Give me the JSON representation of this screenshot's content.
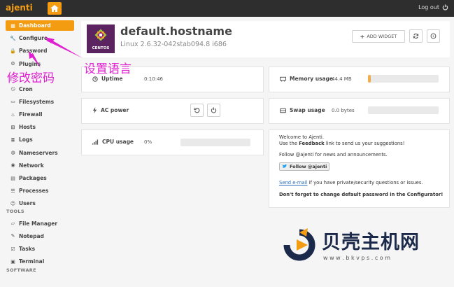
{
  "topbar": {
    "brand": "ajenti",
    "logout": "Log out"
  },
  "sidebar": {
    "items": [
      {
        "label": "Dashboard",
        "icon": "dashboard-icon",
        "active": true
      },
      {
        "label": "Configure",
        "icon": "wrench-icon"
      },
      {
        "label": "Password",
        "icon": "lock-icon"
      },
      {
        "label": "Plugins",
        "icon": "cogs-icon"
      },
      {
        "label": "Cron",
        "icon": "clock-icon"
      },
      {
        "label": "Filesystems",
        "icon": "hdd-icon"
      },
      {
        "label": "Firewall",
        "icon": "fire-icon"
      },
      {
        "label": "Hosts",
        "icon": "sitemap-icon"
      },
      {
        "label": "Logs",
        "icon": "logs-icon"
      },
      {
        "label": "Nameservers",
        "icon": "globe-icon"
      },
      {
        "label": "Network",
        "icon": "network-icon"
      },
      {
        "label": "Packages",
        "icon": "packages-icon"
      },
      {
        "label": "Processes",
        "icon": "list-icon"
      },
      {
        "label": "Users",
        "icon": "users-icon"
      }
    ],
    "tools_heading": "TOOLS",
    "tools": [
      {
        "label": "File Manager",
        "icon": "folder-icon"
      },
      {
        "label": "Notepad",
        "icon": "edit-icon"
      },
      {
        "label": "Tasks",
        "icon": "tasks-icon"
      },
      {
        "label": "Terminal",
        "icon": "terminal-icon"
      }
    ],
    "software_heading": "SOFTWARE"
  },
  "header": {
    "logo_text": "CENTOS",
    "hostname": "default.hostname",
    "kernel": "Linux 2.6.32-042stab094.8 i686",
    "add_widget": "ADD WIDGET"
  },
  "widgets": {
    "uptime": {
      "label": "Uptime",
      "value": "0:10:46"
    },
    "memory": {
      "label": "Memory usage",
      "value": "44.4 MB",
      "fraction": 0.04
    },
    "ac_power": {
      "label": "AC power"
    },
    "swap": {
      "label": "Swap usage",
      "value": "0.0 bytes",
      "fraction": 0
    },
    "cpu": {
      "label": "CPU usage",
      "value": "0%",
      "fraction": 0
    }
  },
  "welcome": {
    "line1": "Welcome to Ajenti.",
    "line2_pre": "Use the ",
    "line2_bold": "Feedback",
    "line2_post": " link to send us your suggestions!",
    "line3": "Follow @ajenti for news and announcements.",
    "follow_btn": "Follow @ajenti",
    "email_link": "Send e-mail",
    "email_post": " if you have private/security questions or issues.",
    "warning": "Don't forget to change default password in the Configurator!"
  },
  "annotations": {
    "language": "设置语言",
    "password": "修改密码"
  },
  "watermark": {
    "brand": "贝壳主机网",
    "url": "w w w . b k v p s . c o m"
  },
  "colors": {
    "accent": "#f39c12",
    "annotation": "#e020d0"
  }
}
